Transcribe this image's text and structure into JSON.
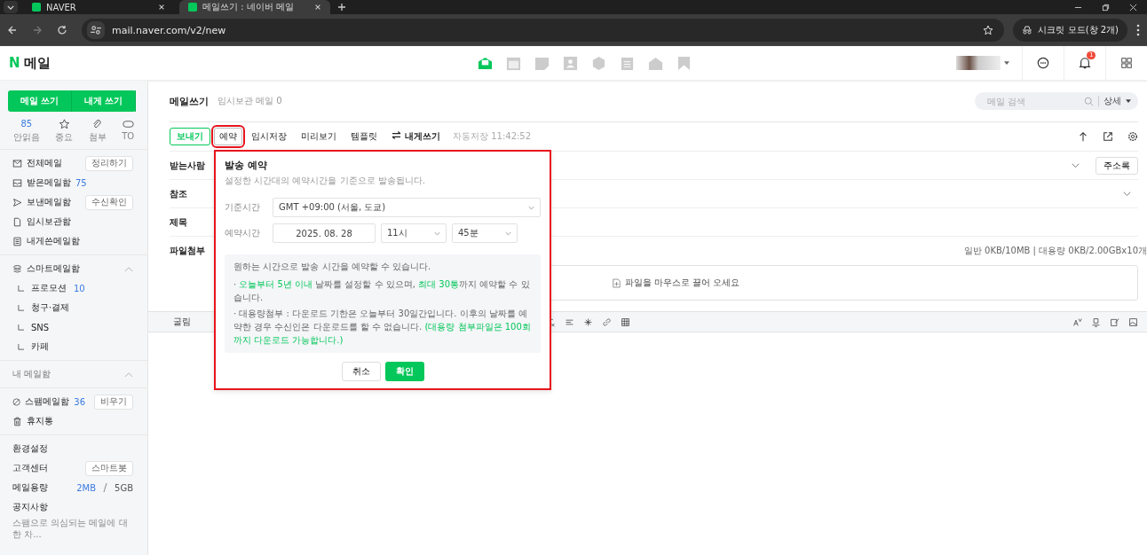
{
  "browser": {
    "tabs": [
      {
        "title": "NAVER",
        "selected": false
      },
      {
        "title": "메일쓰기 : 네이버 메일",
        "selected": true
      }
    ],
    "url": "mail.naver.com/v2/new",
    "incognito": "시크릿 모드(창 2개)"
  },
  "header": {
    "logo_letter": "N",
    "logo_text": "메일",
    "notification_count": "1"
  },
  "sidebar": {
    "compose": "메일 쓰기",
    "self_compose": "내게 쓰기",
    "quick": [
      {
        "kind": "count",
        "value": "85",
        "label": "안읽음"
      },
      {
        "kind": "star",
        "label": "중요"
      },
      {
        "kind": "clip",
        "label": "첨부"
      },
      {
        "kind": "to",
        "label": "TO"
      }
    ],
    "folders": [
      {
        "kind": "all",
        "label": "전체메일",
        "action": "정리하기"
      },
      {
        "kind": "inbox",
        "label": "받은메일함",
        "count": "75"
      },
      {
        "kind": "sent",
        "label": "보낸메일함",
        "action": "수신확인"
      },
      {
        "kind": "draft",
        "label": "임시보관함"
      },
      {
        "kind": "self",
        "label": "내게쓴메일함"
      }
    ],
    "smart": {
      "label": "스마트메일함",
      "expanded": true,
      "children": [
        {
          "label": "프로모션",
          "count": "10"
        },
        {
          "label": "청구·결제"
        },
        {
          "label": "SNS"
        },
        {
          "label": "카페"
        }
      ]
    },
    "my_section": {
      "label": "내 메일함",
      "expanded": true
    },
    "bottom_folders": [
      {
        "kind": "spam",
        "label": "스팸메일함",
        "count": "36",
        "action": "비우기"
      },
      {
        "kind": "trash",
        "label": "휴지통"
      }
    ],
    "links": [
      {
        "label": "환경설정"
      },
      {
        "label": "고객센터",
        "action": "스마트봇"
      }
    ],
    "storage": {
      "label": "메일용량",
      "used": "2MB",
      "total": "5GB"
    },
    "notice": {
      "label": "공지사항",
      "text": "스팸으로 의심되는 메일에 대한 차..."
    }
  },
  "compose": {
    "title": "메일쓰기",
    "draft_info": "임시보관 메일 0",
    "search_placeholder": "메일 검색",
    "detail": "상세",
    "toolbar": [
      {
        "kind": "send",
        "label": "보내기",
        "highlighted": false
      },
      {
        "kind": "reserve",
        "label": "예약",
        "highlighted": true
      },
      {
        "kind": "plain",
        "label": "임시저장",
        "highlighted": false
      },
      {
        "kind": "plain",
        "label": "미리보기",
        "highlighted": false
      },
      {
        "kind": "plain",
        "label": "템플릿",
        "highlighted": false
      },
      {
        "kind": "self",
        "label": "내게쓰기",
        "highlighted": false
      }
    ],
    "autosave": "자동저장 11:42:52",
    "fields": [
      {
        "label": "받는사람",
        "button": "주소록"
      },
      {
        "label": "참조"
      },
      {
        "label": "제목"
      },
      {
        "label": "파일첨부"
      }
    ],
    "attach_info": "일반 0KB/10MB | 대용량 0KB/2.00GBx10개",
    "drop_hint": "파일을 마우스로 끌어 오세요",
    "font": "굴림"
  },
  "schedule_popup": {
    "highlighted": true,
    "title": "발송 예약",
    "subtitle": "설정한 시간대의 예약시간을 기준으로 발송됩니다.",
    "timezone_label": "기준시간",
    "timezone": "GMT +09:00 (서울, 도쿄)",
    "time_label": "예약시간",
    "date": "2025. 08. 28",
    "hour": "11시",
    "minute": "45분",
    "info_title": "원하는 시간으로 발송 시간을 예약할 수 있습니다.",
    "notes": [
      "· **오늘부터 5년 이내** 날짜를 설정할 수 있으며, **최대 30통**까지 예약할 수 있습니다.",
      "· 대용량첨부 : 다운로드 기한은 오늘부터 30일간입니다. 이후의 날짜를 예약한 경우 수신인은 다운로드를 할 수 없습니다. **(대용량 첨부파일은 100회까지 다운로드 가능합니다.)**"
    ],
    "cancel": "취소",
    "confirm": "확인"
  }
}
